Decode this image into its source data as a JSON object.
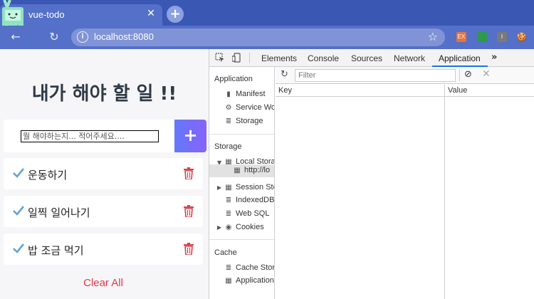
{
  "browser": {
    "tab_title": "vue-todo",
    "new_tab_symbol": "+",
    "close_symbol": "✕",
    "url": "localhost:8080",
    "extensions": [
      {
        "name": "ex-extension-icon",
        "label": "EX",
        "color": "#e8743b"
      },
      {
        "name": "green-extension-icon",
        "label": "",
        "color": "#2e9a4a"
      },
      {
        "name": "grey-extension-icon",
        "label": "I",
        "color": "#7a7a7a"
      },
      {
        "name": "cookie-extension-icon",
        "label": "🍪",
        "color": "transparent"
      }
    ]
  },
  "app": {
    "title": "내가 해야 할 일 !!",
    "input_placeholder": "뭘 해야하는지... 적어주세요....",
    "add_symbol": "+",
    "todos": [
      {
        "text": "운동하기"
      },
      {
        "text": "일찍 일어나기"
      },
      {
        "text": "밥 조금 먹기"
      }
    ],
    "clear_all": "Clear All",
    "accent": "#6d72fb",
    "check_color": "#62a3d6",
    "trash_color": "#d6404c"
  },
  "devtools": {
    "tabs": [
      "Elements",
      "Console",
      "Sources",
      "Network",
      "Application"
    ],
    "active_tab": "Application",
    "more_symbol": "»",
    "sidebar": {
      "application_header": "Application",
      "application_items": [
        "Manifest",
        "Service Wo",
        "Storage"
      ],
      "storage_header": "Storage",
      "storage_items": [
        "Local Stora",
        "http://lo",
        "Session Sto",
        "IndexedDB",
        "Web SQL",
        "Cookies"
      ],
      "cache_header": "Cache",
      "cache_items": [
        "Cache Stor",
        "Application"
      ]
    },
    "filter_placeholder": "Filter",
    "columns": {
      "key": "Key",
      "value": "Value"
    }
  }
}
